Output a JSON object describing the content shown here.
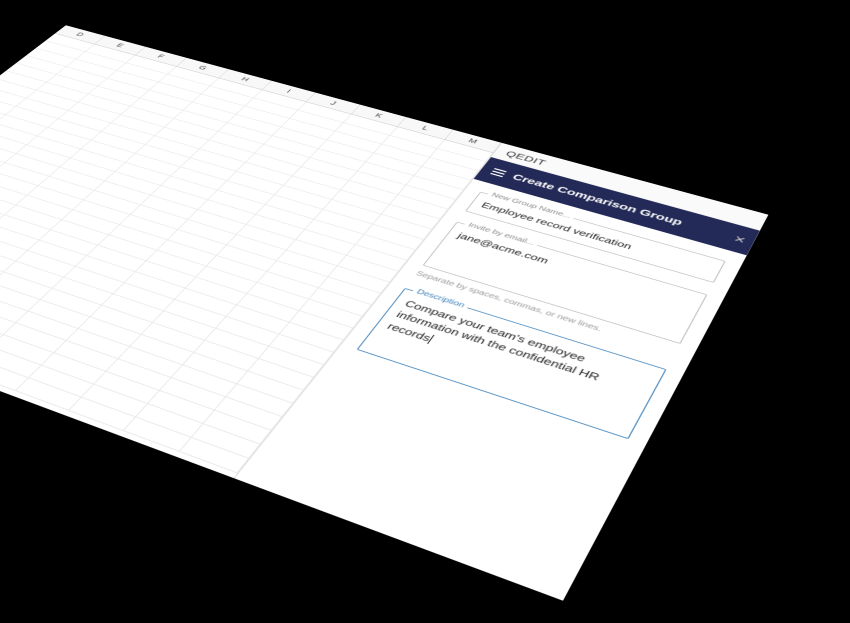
{
  "spreadsheet": {
    "columns": [
      "D",
      "E",
      "F",
      "G",
      "H",
      "I",
      "J",
      "K",
      "L",
      "M"
    ],
    "visible_rows": 28
  },
  "panel": {
    "brand": "QEDIT",
    "title": "Create Comparison Group",
    "fields": {
      "group_name": {
        "label": "New Group Name...",
        "value": "Employee record verification"
      },
      "invite": {
        "label": "Invite by email...",
        "value": "jane@acme.com",
        "hint": "Separate by spaces, commas, or new lines."
      },
      "description": {
        "label": "Description",
        "value": "Compare your team's employee information with the confidential HR records"
      }
    }
  }
}
